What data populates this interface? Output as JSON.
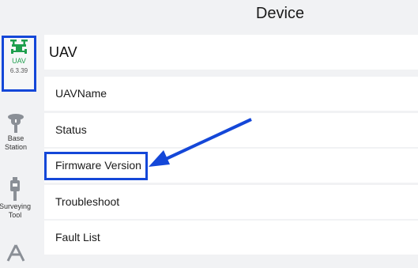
{
  "header": {
    "title": "Device"
  },
  "sidebar": {
    "items": [
      {
        "label": "UAV",
        "version": "6.3.39",
        "icon": "drone-icon",
        "color": "#1e9f4d"
      },
      {
        "label": "Base Station",
        "icon": "base-station-icon"
      },
      {
        "label": "Surveying Tool",
        "icon": "surveying-tool-icon"
      },
      {
        "label": "",
        "icon": "triangle-tool-icon"
      }
    ]
  },
  "main": {
    "section_title": "UAV",
    "rows": [
      {
        "label": "UAVName"
      },
      {
        "label": "Status"
      },
      {
        "label": "Firmware Version"
      },
      {
        "label": "Troubleshoot"
      },
      {
        "label": "Fault List"
      }
    ]
  },
  "annotation": {
    "highlight_color": "#1447d8",
    "arrow_target": "Firmware Version"
  }
}
